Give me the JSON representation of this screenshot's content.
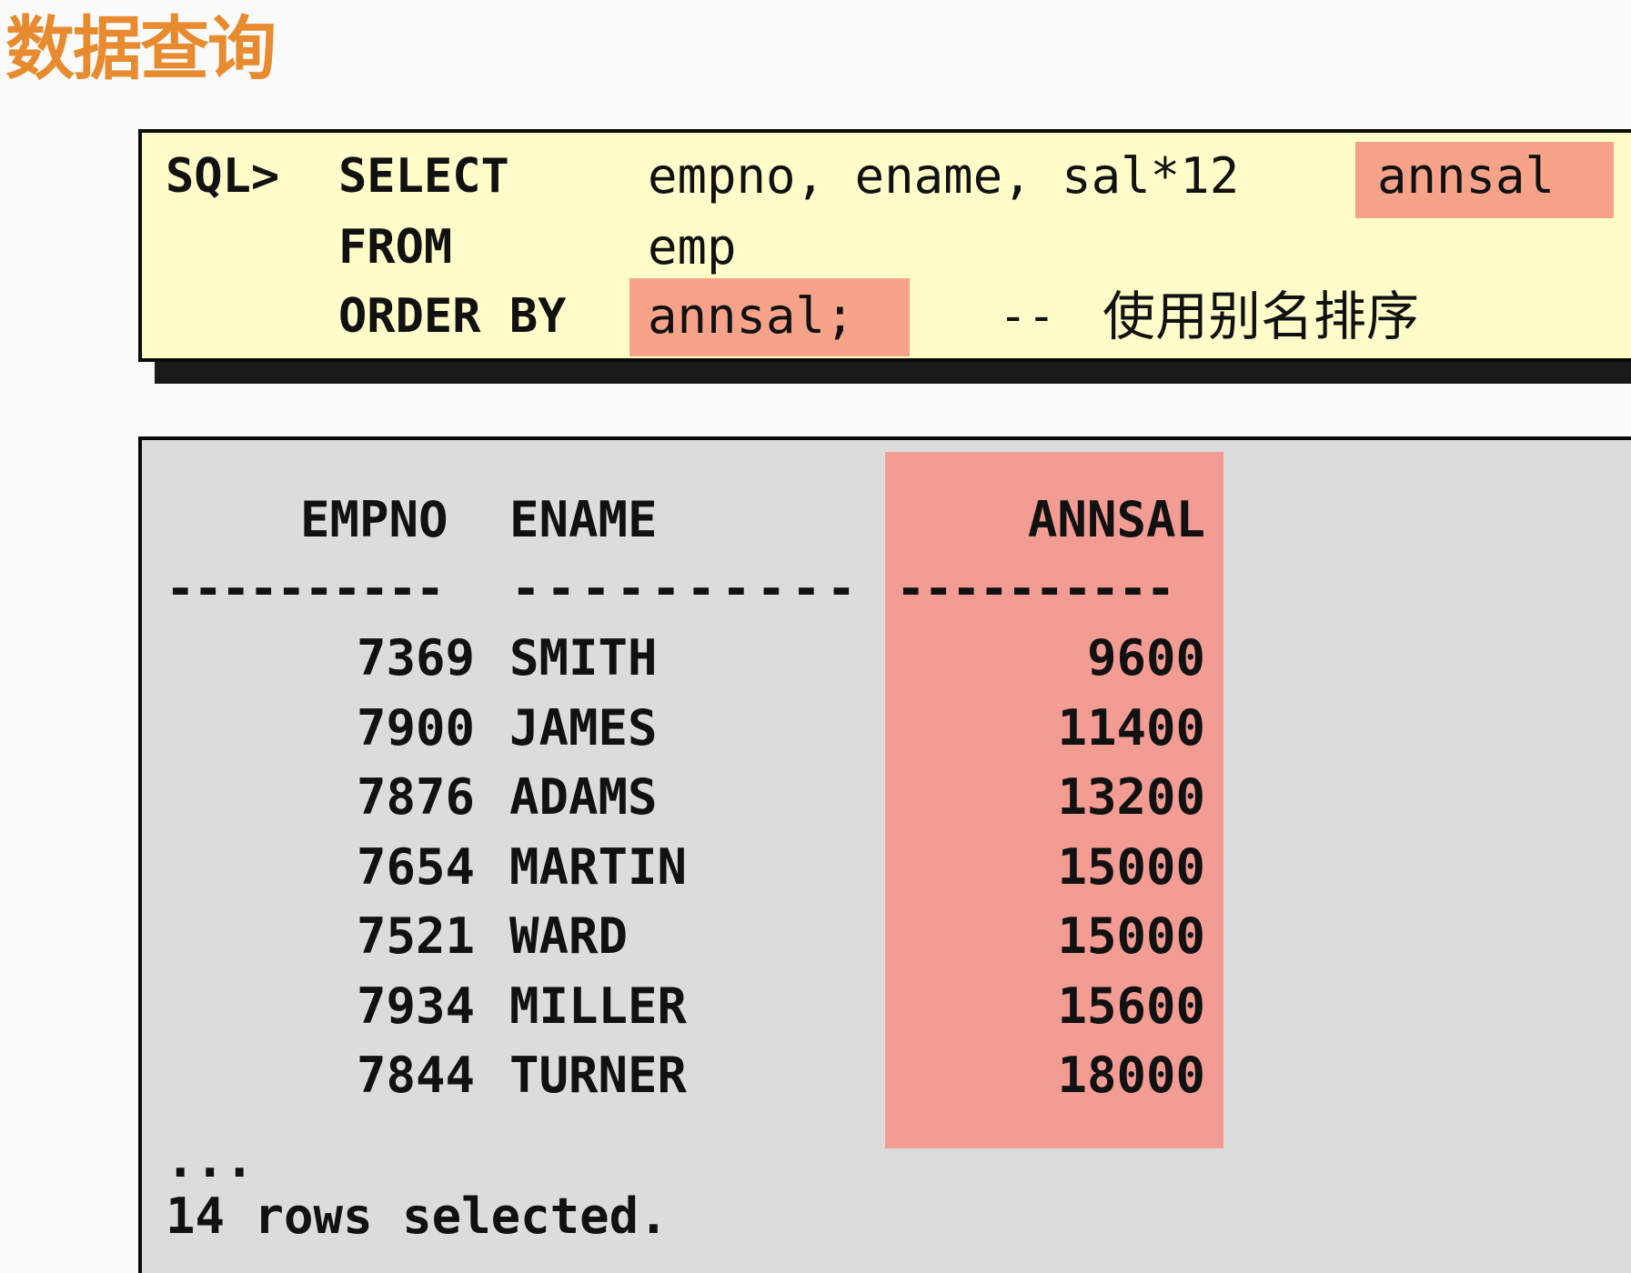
{
  "title": "数据查询",
  "sql": {
    "prompt": "SQL>",
    "select_kw": "SELECT",
    "select_cols": "empno, ename, sal*12",
    "alias": "annsal",
    "from_kw": "FROM",
    "from_table": "emp",
    "order_kw": "ORDER BY",
    "order_val": "annsal;",
    "comment_dashes": "--",
    "comment_text": "使用别名排序"
  },
  "result": {
    "headers": [
      "EMPNO",
      "ENAME",
      "ANNSAL"
    ],
    "separators": [
      "----------",
      "----------",
      "----------"
    ],
    "rows": [
      {
        "empno": "7369",
        "ename": "SMITH",
        "annsal": "9600"
      },
      {
        "empno": "7900",
        "ename": "JAMES",
        "annsal": "11400"
      },
      {
        "empno": "7876",
        "ename": "ADAMS",
        "annsal": "13200"
      },
      {
        "empno": "7654",
        "ename": "MARTIN",
        "annsal": "15000"
      },
      {
        "empno": "7521",
        "ename": "WARD",
        "annsal": "15000"
      },
      {
        "empno": "7934",
        "ename": "MILLER",
        "annsal": "15600"
      },
      {
        "empno": "7844",
        "ename": "TURNER",
        "annsal": "18000"
      }
    ],
    "ellipsis": "...",
    "footer": "14 rows selected."
  },
  "colors": {
    "title": "#e88a2e",
    "sql_background": "#fefcc9",
    "highlight": "#f6a38a",
    "result_background": "#dcdcdc",
    "column_highlight": "#f39c94"
  }
}
